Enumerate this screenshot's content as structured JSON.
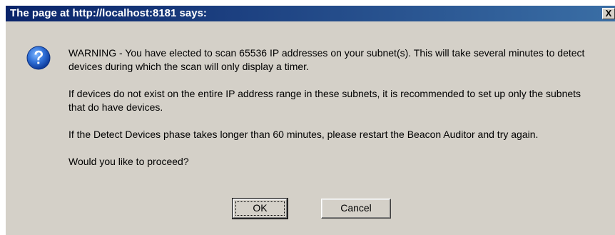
{
  "dialog": {
    "title": "The page at http://localhost:8181 says:",
    "close_label": "X",
    "icon": "question-icon",
    "title_bar_color": "#0a246a",
    "background_color": "#d4d0c8",
    "paragraphs": [
      "WARNING - You have elected to scan 65536 IP addresses on your subnet(s).  This will take several minutes to detect devices during which the scan will only display a timer.",
      "If devices do not exist on the entire IP address range in these subnets, it is recommended to set up only the subnets that do have devices.",
      "If the Detect Devices phase takes longer than 60 minutes, please restart the Beacon Auditor and try again.",
      "Would you like to proceed?"
    ],
    "buttons": {
      "ok_label": "OK",
      "cancel_label": "Cancel"
    }
  }
}
